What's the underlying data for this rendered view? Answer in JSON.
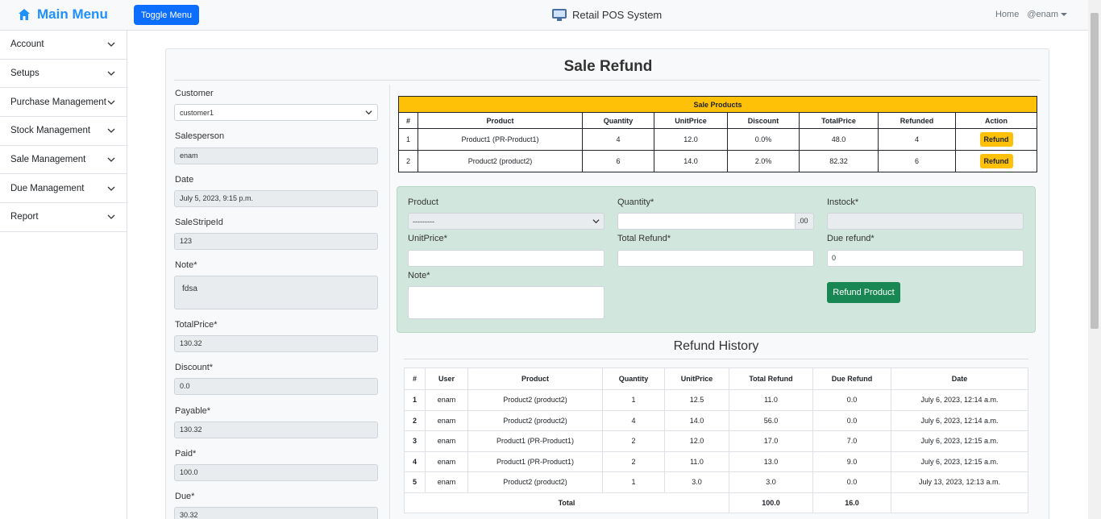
{
  "navbar": {
    "brand": "Main Menu",
    "toggle_label": "Toggle Menu",
    "app_title": "Retail POS System",
    "home_link": "Home",
    "user_menu": "@enam"
  },
  "sidebar": {
    "items": [
      {
        "label": "Account"
      },
      {
        "label": "Setups"
      },
      {
        "label": "Purchase Management"
      },
      {
        "label": "Stock Management"
      },
      {
        "label": "Sale Management"
      },
      {
        "label": "Due Management"
      },
      {
        "label": "Report"
      }
    ]
  },
  "page": {
    "title": "Sale Refund"
  },
  "left_form": {
    "customer_label": "Customer",
    "customer_value": "customer1",
    "salesperson_label": "Salesperson",
    "salesperson_value": "enam",
    "date_label": "Date",
    "date_value": "July 5, 2023, 9:15 p.m.",
    "stripe_label": "SaleStripeId",
    "stripe_value": "123",
    "note_label": "Note*",
    "note_value": "fdsa",
    "total_label": "TotalPrice*",
    "total_value": "130.32",
    "discount_label": "Discount*",
    "discount_value": "0.0",
    "payable_label": "Payable*",
    "payable_value": "130.32",
    "paid_label": "Paid*",
    "paid_value": "100.0",
    "due_label": "Due*",
    "due_value": "30.32"
  },
  "sale_products": {
    "caption": "Sale Products",
    "headers": [
      "#",
      "Product",
      "Quantity",
      "UnitPrice",
      "Discount",
      "TotalPrice",
      "Refunded",
      "Action"
    ],
    "rows": [
      {
        "num": "1",
        "product": "Product1 (PR-Product1)",
        "quantity": "4",
        "unit_price": "12.0",
        "discount": "0.0%",
        "total": "48.0",
        "refunded": "4",
        "action": "Refund"
      },
      {
        "num": "2",
        "product": "Product2 (product2)",
        "quantity": "6",
        "unit_price": "14.0",
        "discount": "2.0%",
        "total": "82.32",
        "refunded": "6",
        "action": "Refund"
      }
    ]
  },
  "refund_form": {
    "product_label": "Product",
    "product_value": "---------",
    "quantity_label": "Quantity*",
    "quantity_addon": ".00",
    "instock_label": "Instock*",
    "unitprice_label": "UnitPrice*",
    "total_refund_label": "Total Refund*",
    "due_refund_label": "Due refund*",
    "due_refund_value": "0",
    "note_label": "Note*",
    "submit_label": "Refund Product"
  },
  "refund_history": {
    "title": "Refund History",
    "headers": [
      "#",
      "User",
      "Product",
      "Quantity",
      "UnitPrice",
      "Total Refund",
      "Due Refund",
      "Date"
    ],
    "rows": [
      {
        "num": "1",
        "user": "enam",
        "product": "Product2 (product2)",
        "quantity": "1",
        "unit_price": "12.5",
        "total_refund": "11.0",
        "due_refund": "0.0",
        "date": "July 6, 2023, 12:14 a.m."
      },
      {
        "num": "2",
        "user": "enam",
        "product": "Product2 (product2)",
        "quantity": "4",
        "unit_price": "14.0",
        "total_refund": "56.0",
        "due_refund": "0.0",
        "date": "July 6, 2023, 12:14 a.m."
      },
      {
        "num": "3",
        "user": "enam",
        "product": "Product1 (PR-Product1)",
        "quantity": "2",
        "unit_price": "12.0",
        "total_refund": "17.0",
        "due_refund": "7.0",
        "date": "July 6, 2023, 12:15 a.m."
      },
      {
        "num": "4",
        "user": "enam",
        "product": "Product1 (PR-Product1)",
        "quantity": "2",
        "unit_price": "11.0",
        "total_refund": "13.0",
        "due_refund": "9.0",
        "date": "July 6, 2023, 12:15 a.m."
      },
      {
        "num": "5",
        "user": "enam",
        "product": "Product2 (product2)",
        "quantity": "1",
        "unit_price": "3.0",
        "total_refund": "3.0",
        "due_refund": "0.0",
        "date": "July 13, 2023, 12:13 a.m."
      }
    ],
    "total_label": "Total",
    "total_refund_sum": "100.0",
    "due_refund_sum": "16.0"
  },
  "colors": {
    "primary": "#0d6efd",
    "brand": "#1e90ff",
    "warning": "#ffc107",
    "success": "#198754",
    "green_panel": "#d1e7dd"
  },
  "icons": {
    "brand": "home-icon",
    "app_logo": "pos-logo-icon",
    "sidebar_chevron": "chevron-down-icon",
    "select_chevron": "chevron-down-icon"
  }
}
